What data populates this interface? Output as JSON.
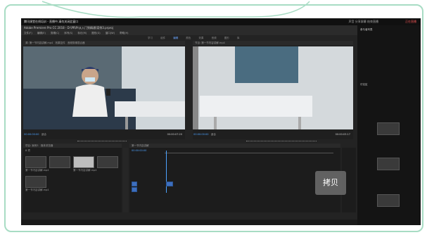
{
  "screen": {
    "title": "腾讯课堂在线培训 - 直播中,请勿关闭此窗口",
    "status_live": "正在直播",
    "status_hint": "声音  分享屏幕  结束直播"
  },
  "app": {
    "title": "Adobe Premiere Pro CC 2018 - D:\\PR\\Pr从入门到精通\\案例3.prproj",
    "menu": [
      "文件(F)",
      "编辑(E)",
      "剪辑(C)",
      "序列(S)",
      "标记(M)",
      "图形(G)",
      "窗口(W)",
      "帮助(H)"
    ],
    "workspaces": [
      "学习",
      "组件",
      "编辑",
      "颜色",
      "效果",
      "音频",
      "图形",
      "库"
    ],
    "active_workspace": "编辑"
  },
  "source_monitor": {
    "tab": "源: 第一节内容讲解.mp4",
    "tab2": "效果控件",
    "tab3": "音频剪辑混合器",
    "timecode_in": "00:00:00:00",
    "fit": "适合",
    "timecode_out": "00:00:07:20"
  },
  "program_monitor": {
    "tab": "节目: 第一节内容讲解.mp4",
    "timecode_in": "00:00:00:00",
    "fit": "适合",
    "timecode_out": "00:00:03:17"
  },
  "project": {
    "tab": "项目: 案例3",
    "tab2": "媒体浏览器",
    "item_count": "8 项",
    "clips": [
      "第一节内容讲解.mp4",
      "第一节内容讲解.mp4",
      "第一节内容讲解.mp4",
      "第一节内容讲解.mp4",
      "第一节内容讲解.mp4"
    ]
  },
  "timeline": {
    "tab": "第一节内容讲解",
    "timecode": "00:00:00:00"
  },
  "sidebar": {
    "header": "参与者列表",
    "chat": "讨论区"
  },
  "overlay": {
    "copy_label": "拷贝"
  }
}
